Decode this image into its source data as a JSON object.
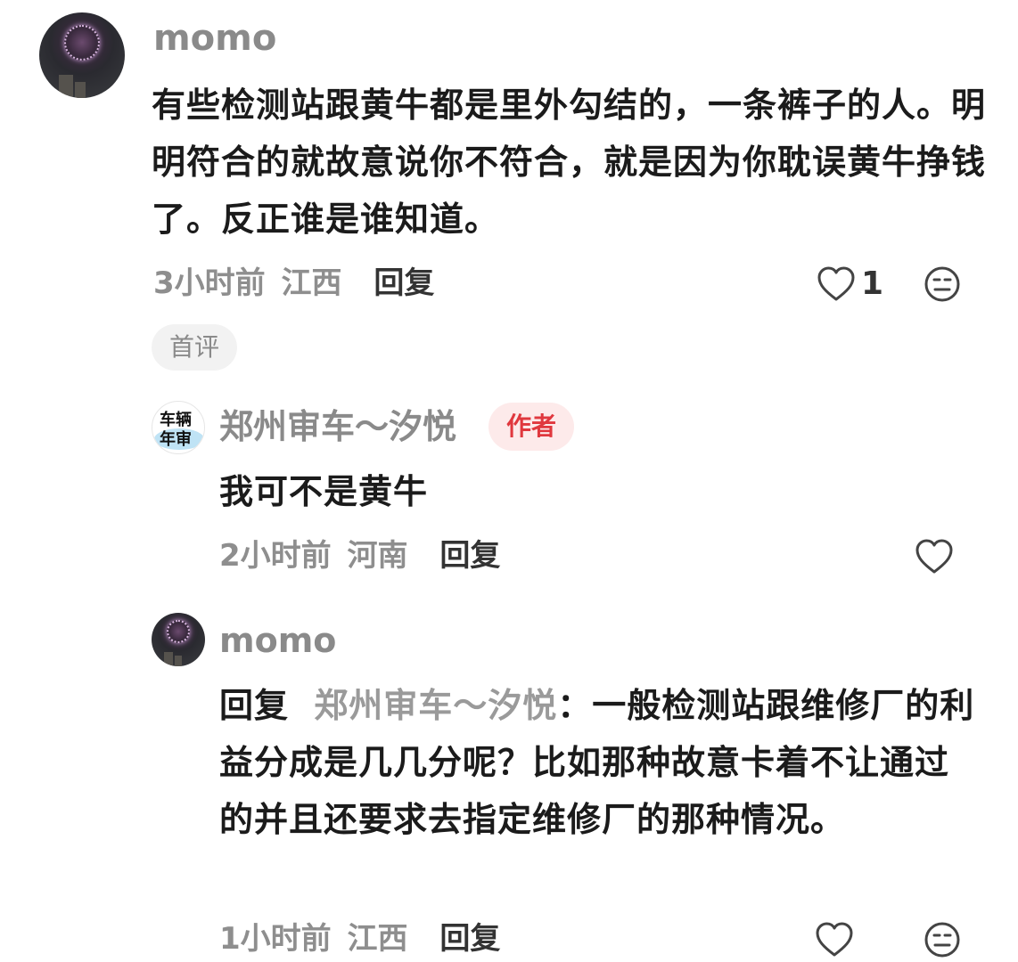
{
  "comments": [
    {
      "username": "momo",
      "text": "有些检测站跟黄牛都是里外勾结的，一条裤子的人。明明符合的就故意说你不符合，就是因为你耽误黄牛挣钱了。反正谁是谁知道。",
      "time": "3小时前",
      "location": "江西",
      "reply_label": "回复",
      "like_count": "1",
      "tag": "首评",
      "avatar_icon": "fireworks-avatar"
    },
    {
      "username": "郑州审车～汐悦",
      "badge": "作者",
      "text": "我可不是黄牛",
      "time": "2小时前",
      "location": "河南",
      "reply_label": "回复",
      "avatar_icon": "vehicle-inspection-logo-avatar",
      "avatar_text_line1": "车辆",
      "avatar_text_line2": "年审"
    },
    {
      "username": "momo",
      "reply_prefix": "回复",
      "reply_to": "郑州审车～汐悦",
      "reply_colon": "：",
      "text": "一般检测站跟维修厂的利益分成是几几分呢？比如那种故意卡着不让通过的并且还要求去指定维修厂的那种情况。",
      "time": "1小时前",
      "location": "江西",
      "reply_label": "回复",
      "avatar_icon": "fireworks-avatar"
    }
  ],
  "colors": {
    "username": "#8a8a8a",
    "body": "#1b1b1b",
    "author_badge_bg": "#fdeaea",
    "author_badge_text": "#e0383e",
    "tag_bg": "#f2f2f2"
  }
}
